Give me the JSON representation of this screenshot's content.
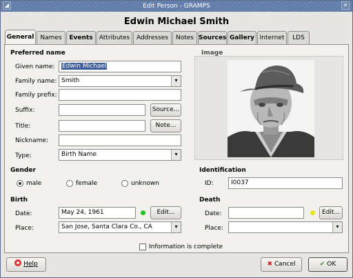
{
  "window": {
    "title": "Edit Person - GRAMPS"
  },
  "header": {
    "name": "Edwin Michael Smith"
  },
  "tabs": [
    {
      "label": "General",
      "active": true
    },
    {
      "label": "Names"
    },
    {
      "label": "Events",
      "bold": true
    },
    {
      "label": "Attributes"
    },
    {
      "label": "Addresses"
    },
    {
      "label": "Notes"
    },
    {
      "label": "Sources",
      "bold": true
    },
    {
      "label": "Gallery",
      "bold": true
    },
    {
      "label": "Internet"
    },
    {
      "label": "LDS"
    }
  ],
  "preferred_name": {
    "section_label": "Preferred name",
    "given_label": "Given name:",
    "given_value": "Edwin Michael",
    "family_label": "Family name:",
    "family_value": "Smith",
    "prefix_label": "Family prefix:",
    "prefix_value": "",
    "suffix_label": "Suffix:",
    "suffix_value": "",
    "source_button": "Source...",
    "title_label": "Title:",
    "title_value": "",
    "note_button": "Note...",
    "nickname_label": "Nickname:",
    "nickname_value": "",
    "type_label": "Type:",
    "type_value": "Birth Name"
  },
  "image": {
    "section_label": "Image"
  },
  "gender": {
    "section_label": "Gender",
    "options": [
      "male",
      "female",
      "unknown"
    ],
    "selected": "male"
  },
  "identification": {
    "section_label": "Identification",
    "id_label": "ID:",
    "id_value": "I0037"
  },
  "birth": {
    "section_label": "Birth",
    "date_label": "Date:",
    "date_value": "May 24, 1961",
    "status_color": "#22c222",
    "edit_button": "Edit...",
    "place_label": "Place:",
    "place_value": "San Jose, Santa Clara Co., CA"
  },
  "death": {
    "section_label": "Death",
    "date_label": "Date:",
    "date_value": "",
    "status_color": "#e8e21a",
    "edit_button": "Edit...",
    "place_label": "Place:",
    "place_value": ""
  },
  "complete": {
    "label": "Information is complete",
    "checked": false
  },
  "footer": {
    "help": "Help",
    "cancel": "Cancel",
    "ok": "OK"
  },
  "icons": {
    "combo_arrow": "chevron-down-icon",
    "help": "help-lifebuoy-icon",
    "cancel": "cancel-x-icon",
    "ok": "ok-check-icon",
    "close": "close-icon",
    "menu": "window-menu-icon"
  }
}
